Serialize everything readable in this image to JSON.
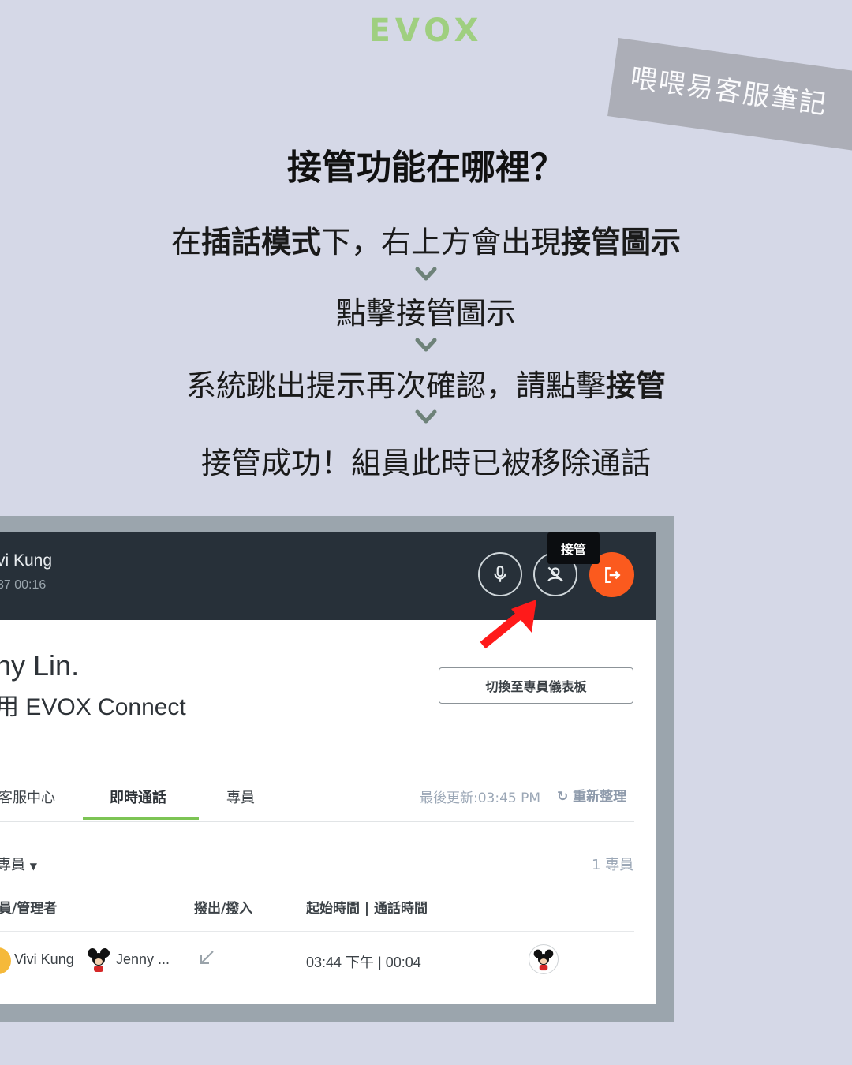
{
  "brand": {
    "logo": "EVOX"
  },
  "tape": {
    "text": "喂喂易客服筆記"
  },
  "headline": "接管功能在哪裡？",
  "steps": {
    "s1": {
      "a": "在",
      "b": "插話模式",
      "c": "下，右上方會出現",
      "d": "接管圖示"
    },
    "s2": "點擊接管圖示",
    "s3": {
      "a": "系統跳出提示再次確認，請點擊",
      "b": "接管"
    },
    "s4": "接管成功！組員此時已被移除通話"
  },
  "call": {
    "caller_name": "vi Kung",
    "caller_time": "37  00:16",
    "tooltip": "接管",
    "icons": [
      "microphone-icon",
      "takeover-icon",
      "exit-icon"
    ],
    "accent": "#fb5a1e"
  },
  "welcome": {
    "line1": "ny Lin.",
    "line2": "用 EVOX Connect"
  },
  "switch_button": "切換至專員儀表板",
  "tabs": [
    {
      "label": "客服中心"
    },
    {
      "label": "即時通話",
      "active": true
    },
    {
      "label": "專員"
    }
  ],
  "tab_accent": "#7cc454",
  "last_update": "最後更新:03:45 PM",
  "refresh": "重新整理",
  "filter_label": "專員",
  "agent_count": "1 專員",
  "table": {
    "headers": [
      "員/管理者",
      "撥出/撥入",
      "起始時間 | 通話時間"
    ],
    "rows": [
      {
        "agent": "Vivi Kung",
        "member": "Jenny ...",
        "time": "03:44 下午 | 00:04"
      }
    ]
  }
}
